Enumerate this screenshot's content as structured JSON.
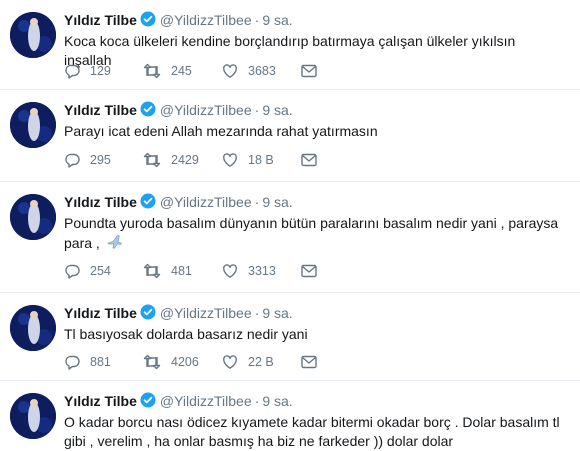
{
  "colors": {
    "name": "#14171a",
    "meta": "#657786",
    "verified": "#1da1f2",
    "divider": "#e6ecf0"
  },
  "tweets": [
    {
      "name": "Yıldız Tilbe",
      "handle": "@YildizzTilbee",
      "dot": "·",
      "time": "9 sa.",
      "text": "Koca koca ülkeleri kendine borçlandırıp batırmaya çalışan ülkeler  yıkılsın inşallah",
      "replies": "129",
      "retweets": "245",
      "likes": "3683"
    },
    {
      "name": "Yıldız Tilbe",
      "handle": "@YildizzTilbee",
      "dot": "·",
      "time": "9 sa.",
      "text": "Parayı icat edeni Allah mezarında rahat yatırmasın",
      "replies": "295",
      "retweets": "2429",
      "likes": "18 B"
    },
    {
      "name": "Yıldız Tilbe",
      "handle": "@YildizzTilbee",
      "dot": "·",
      "time": "9 sa.",
      "text": "Poundta yuroda basalım dünyanın bütün paralarını basalım nedir yani , paraysa para ,",
      "emoji": "airplane-emoji",
      "replies": "254",
      "retweets": "481",
      "likes": "3313"
    },
    {
      "name": "Yıldız Tilbe",
      "handle": "@YildizzTilbee",
      "dot": "·",
      "time": "9 sa.",
      "text": "Tl basıyosak dolarda basarız nedir yani",
      "replies": "881",
      "retweets": "4206",
      "likes": "22 B"
    },
    {
      "name": "Yıldız Tilbe",
      "handle": "@YildizzTilbee",
      "dot": "·",
      "time": "9 sa.",
      "text": "O kadar borcu nası ödicez kıyamete kadar bitermi okadar borç . Dolar basalım tl gibi , verelim , ha onlar basmış ha biz ne farkeder )) dolar dolar"
    }
  ]
}
